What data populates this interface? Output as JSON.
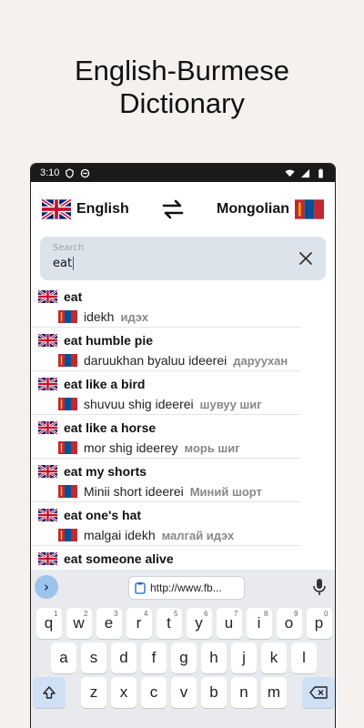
{
  "promo": {
    "line1": "English-Burmese",
    "line2": "Dictionary"
  },
  "status": {
    "time": "3:10"
  },
  "lang": {
    "source": "English",
    "target": "Mongolian"
  },
  "search": {
    "placeholder": "Search",
    "value": "eat"
  },
  "results": [
    {
      "term": "eat",
      "translit": "idekh",
      "cyrillic": "идэх"
    },
    {
      "term": "eat humble pie",
      "translit": "daruukhan byaluu ideerei",
      "cyrillic": "дарууxан"
    },
    {
      "term": "eat like a bird",
      "translit": "shuvuu shig ideerei",
      "cyrillic": "шувуу шиг"
    },
    {
      "term": "eat like a horse",
      "translit": "mor shig ideerey",
      "cyrillic": "морь шиг"
    },
    {
      "term": "eat my shorts",
      "translit": "Minii short ideerei",
      "cyrillic": "Миний шорт"
    },
    {
      "term": "eat one's hat",
      "translit": "malgai idekh",
      "cyrillic": "малгай идэх"
    },
    {
      "term": "eat someone alive",
      "translit": "",
      "cyrillic": ""
    }
  ],
  "keyboard": {
    "url": "http://www.fb...",
    "row1": [
      {
        "k": "q",
        "n": "1"
      },
      {
        "k": "w",
        "n": "2"
      },
      {
        "k": "e",
        "n": "3"
      },
      {
        "k": "r",
        "n": "4"
      },
      {
        "k": "t",
        "n": "5"
      },
      {
        "k": "y",
        "n": "6"
      },
      {
        "k": "u",
        "n": "7"
      },
      {
        "k": "i",
        "n": "8"
      },
      {
        "k": "o",
        "n": "9"
      },
      {
        "k": "p",
        "n": "0"
      }
    ],
    "row2": [
      "a",
      "s",
      "d",
      "f",
      "g",
      "h",
      "j",
      "k",
      "l"
    ],
    "row3": [
      "z",
      "x",
      "c",
      "v",
      "b",
      "n",
      "m"
    ]
  },
  "colors": {
    "search_bg": "#dde3ea",
    "accent": "#1565c0",
    "keyboard_bg": "#e8eaed"
  }
}
